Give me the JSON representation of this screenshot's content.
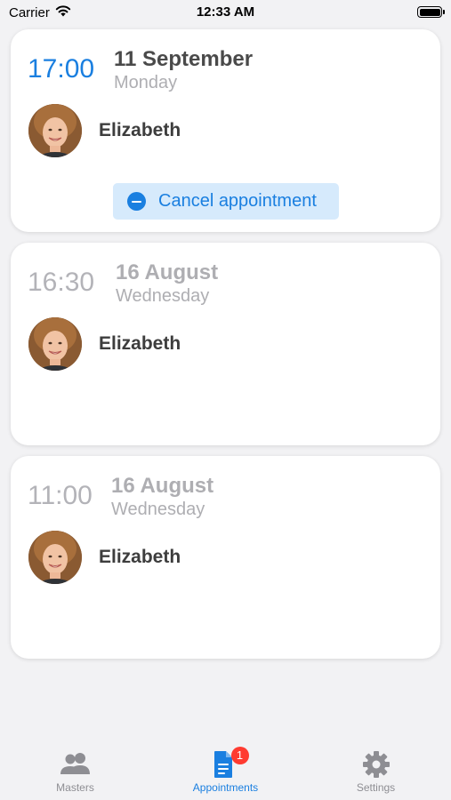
{
  "status_bar": {
    "carrier": "Carrier",
    "time": "12:33 AM",
    "wifi_icon": "wifi-icon",
    "battery_icon": "battery-icon"
  },
  "appointments": [
    {
      "time": "17:00",
      "date": "11 September",
      "weekday": "Monday",
      "master": "Elizabeth",
      "avatar_icon": "avatar-photo",
      "cancel_label": "Cancel appointment",
      "active": true
    },
    {
      "time": "16:30",
      "date": "16 August",
      "weekday": "Wednesday",
      "master": "Elizabeth",
      "avatar_icon": "avatar-photo",
      "active": false
    },
    {
      "time": "11:00",
      "date": "16 August",
      "weekday": "Wednesday",
      "master": "Elizabeth",
      "avatar_icon": "avatar-photo",
      "active": false
    }
  ],
  "tab_bar": {
    "tabs": [
      {
        "label": "Masters",
        "icon": "people-icon"
      },
      {
        "label": "Appointments",
        "icon": "document-icon",
        "badge": "1",
        "selected": true
      },
      {
        "label": "Settings",
        "icon": "gear-icon"
      }
    ]
  },
  "colors": {
    "accent": "#1a7fe0",
    "inactive_gray": "#aeaeb2",
    "badge_red": "#ff3b30",
    "button_bg": "#d6eafc",
    "background": "#f2f2f4"
  }
}
